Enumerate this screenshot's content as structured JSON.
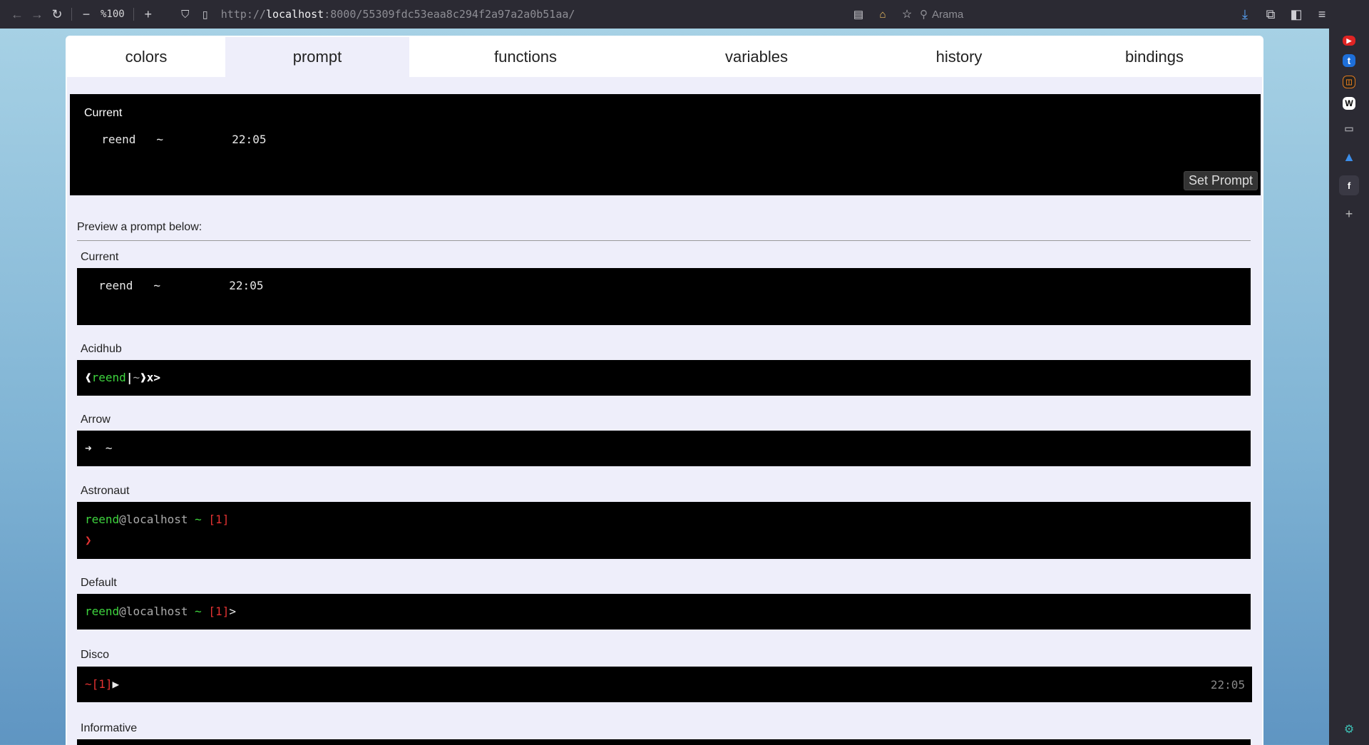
{
  "browser": {
    "zoom": "%100",
    "url_host": "localhost",
    "url_prefix": "http://",
    "url_rest": ":8000/55309fdc53eaa8c294f2a97a2a0b51aa/",
    "search_placeholder": "Arama"
  },
  "tabs": [
    "colors",
    "prompt",
    "functions",
    "variables",
    "history",
    "bindings"
  ],
  "current": {
    "label": "Current",
    "line1": "  reend   ~          22:05  ",
    "line2": " ",
    "button": "Set Prompt"
  },
  "preview": {
    "header": "Preview a prompt below:",
    "prompts": [
      {
        "name": "Current",
        "line1": "  reend   ~          22:05  ",
        "line2": " "
      },
      {
        "name": "Acidhub",
        "open": "❰",
        "user": "reend",
        "bar": "|",
        "dir": "~",
        "close": "❱",
        "tail": "x>"
      },
      {
        "name": "Arrow",
        "text": "➜  ~"
      },
      {
        "name": "Astronaut",
        "user": "reend",
        "host": "@localhost",
        "dir": "~",
        "status": "[1]",
        "prompt": "❯"
      },
      {
        "name": "Default",
        "user": "reend",
        "host": "@localhost",
        "dir": "~",
        "status": "[1]",
        "tail": ">"
      },
      {
        "name": "Disco",
        "dir": "~",
        "status": "[1]",
        "tail": "▶",
        "right": "22:05"
      },
      {
        "name": "Informative"
      }
    ]
  },
  "colors": {
    "green": "#3ed43e",
    "red": "#e33232",
    "toolbar": "#2b2a33"
  }
}
